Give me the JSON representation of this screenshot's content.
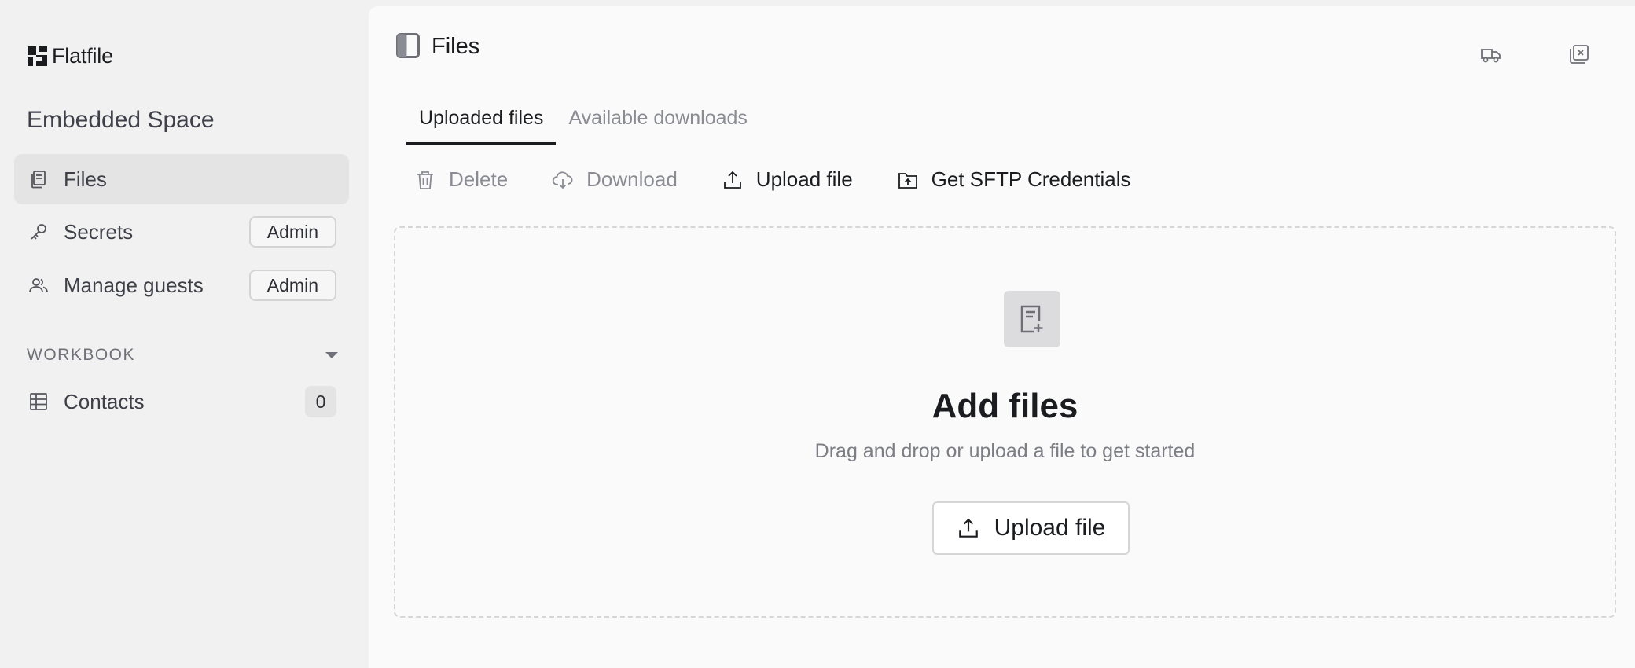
{
  "brand": {
    "name": "Flatfile"
  },
  "space": {
    "title": "Embedded Space"
  },
  "sidebar": {
    "items": [
      {
        "label": "Files",
        "icon": "files-icon",
        "active": true
      },
      {
        "label": "Secrets",
        "icon": "key-icon",
        "badge": "Admin"
      },
      {
        "label": "Manage guests",
        "icon": "users-icon",
        "badge": "Admin"
      }
    ],
    "workbook_section": {
      "label": "WORKBOOK",
      "items": [
        {
          "label": "Contacts",
          "icon": "table-icon",
          "count": "0"
        }
      ]
    }
  },
  "main": {
    "title": "Files",
    "tabs": [
      {
        "label": "Uploaded files",
        "active": true
      },
      {
        "label": "Available downloads",
        "active": false
      }
    ],
    "toolbar": {
      "delete": "Delete",
      "download": "Download",
      "upload": "Upload file",
      "sftp": "Get SFTP Credentials"
    },
    "dropzone": {
      "title": "Add files",
      "subtitle": "Drag and drop or upload a file to get started",
      "button": "Upload file"
    }
  },
  "colors": {
    "sidebar_bg": "#f1f1f1",
    "main_bg": "#fafafa",
    "active_item_bg": "#e4e4e5",
    "text_primary": "#1b1c1f",
    "text_muted": "#8b8c93"
  }
}
